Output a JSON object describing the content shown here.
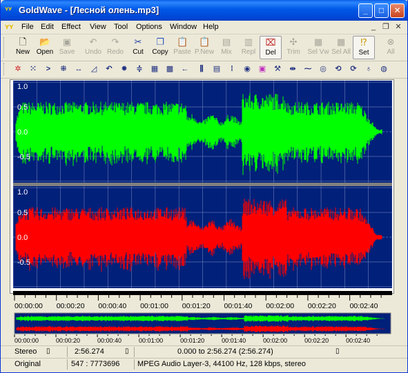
{
  "window": {
    "title": "GoldWave - [Лесной олень.mp3]",
    "icon": "goldwave-logo-icon",
    "controls": [
      "minimize",
      "maximize",
      "close"
    ]
  },
  "menu": {
    "items": [
      "File",
      "Edit",
      "Effect",
      "View",
      "Tool",
      "Options",
      "Window",
      "Help"
    ]
  },
  "toolbar": {
    "buttons": [
      {
        "label": "New",
        "icon": "new-file-icon",
        "enabled": true
      },
      {
        "label": "Open",
        "icon": "open-folder-icon",
        "enabled": true
      },
      {
        "label": "Save",
        "icon": "save-icon",
        "enabled": false
      },
      {
        "label": "Undo",
        "icon": "undo-icon",
        "enabled": false
      },
      {
        "label": "Redo",
        "icon": "redo-icon",
        "enabled": false
      },
      {
        "label": "Cut",
        "icon": "scissors-icon",
        "enabled": true
      },
      {
        "label": "Copy",
        "icon": "copy-icon",
        "enabled": true
      },
      {
        "label": "Paste",
        "icon": "paste-icon",
        "enabled": false
      },
      {
        "label": "P.New",
        "icon": "paste-new-icon",
        "enabled": false
      },
      {
        "label": "Mix",
        "icon": "mix-icon",
        "enabled": false
      },
      {
        "label": "Repl",
        "icon": "replace-icon",
        "enabled": false
      },
      {
        "label": "Del",
        "icon": "delete-icon",
        "enabled": true
      },
      {
        "label": "Trim",
        "icon": "trim-icon",
        "enabled": false
      },
      {
        "label": "Sel Vw",
        "icon": "select-view-icon",
        "enabled": false
      },
      {
        "label": "Sel All",
        "icon": "select-all-icon",
        "enabled": false
      },
      {
        "label": "Set",
        "icon": "set-marker-icon",
        "enabled": true
      },
      {
        "label": "All",
        "icon": "show-all-icon",
        "enabled": false
      }
    ]
  },
  "effects_toolbar": {
    "icons": [
      "effect-1-icon",
      "effect-2-icon",
      "effect-3-icon",
      "effect-4-icon",
      "effect-5-icon",
      "effect-6-icon",
      "effect-7-icon",
      "effect-8-icon",
      "effect-9-icon",
      "effect-10-icon",
      "effect-11-icon",
      "effect-12-icon",
      "effect-13-icon",
      "effect-14-icon",
      "effect-15-icon",
      "effect-16-icon",
      "effect-17-icon",
      "effect-18-icon",
      "effect-19-icon",
      "effect-20-icon",
      "effect-21-icon",
      "effect-22-icon",
      "effect-23-icon",
      "effect-24-icon",
      "effect-25-icon",
      "effect-26-icon",
      "effect-27-icon",
      "effect-28-icon"
    ]
  },
  "waveform": {
    "top_channel_color": "#00ff00",
    "bottom_channel_color": "#ff0000",
    "background": "#00207a",
    "y_labels": [
      "1.0",
      "0.5",
      "0.0",
      "-0.5"
    ],
    "time_labels": [
      "00:00:00",
      "00:00:20",
      "00:00:40",
      "00:01:00",
      "00:01:20",
      "00:01:40",
      "00:02:00",
      "00:02:20",
      "00:02:40"
    ],
    "duration_seconds": 176.274
  },
  "overview": {
    "time_labels": [
      "00:00:00",
      "00:00:20",
      "00:00:40",
      "00:01:00",
      "00:01:20",
      "00:01:40",
      "00:02:00",
      "00:02:20",
      "00:02:40"
    ]
  },
  "status": {
    "channels": "Stereo",
    "length": "2:56.274",
    "selection": "0.000 to 2:56.274 (2:56.274)",
    "mode": "Original",
    "position": "547 : 7773696",
    "format": "MPEG Audio Layer-3, 44100 Hz, 128 kbps, stereo"
  }
}
